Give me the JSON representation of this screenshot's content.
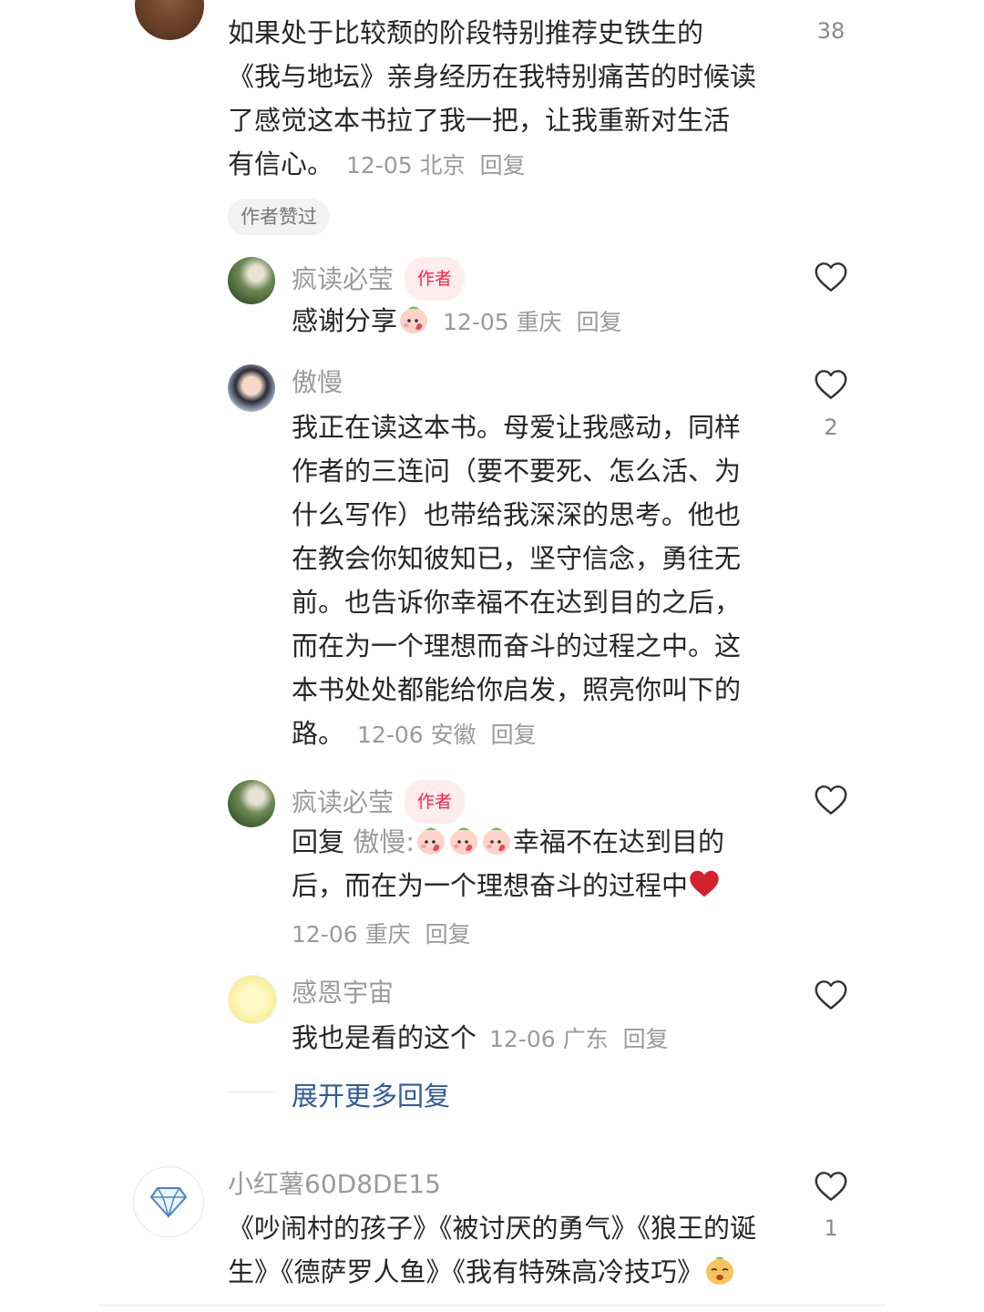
{
  "comments": [
    {
      "text_lines": [
        "如果处于比较颓的阶段特别推荐史铁生的",
        "《我与地坛》亲身经历在我特别痛苦的时候读",
        "了感觉这本书拉了我一把，让我重新对生活",
        "有信心。"
      ],
      "date": "12-05",
      "location": "北京",
      "reply_label": "回复",
      "likes": "38",
      "tag": "作者赞过",
      "replies": [
        {
          "username": "疯读必莹",
          "badge": "作者",
          "text": "感谢分享",
          "date": "12-05",
          "location": "重庆",
          "reply_label": "回复"
        },
        {
          "username": "傲慢",
          "text_lines": [
            "我正在读这本书。母爱让我感动，同样",
            "作者的三连问（要不要死、怎么活、为",
            "什么写作）也带给我深深的思考。他也",
            "在教会你知彼知已，坚守信念，勇往无",
            "前。也告诉你幸福不在达到目的之后，",
            "而在为一个理想而奋斗的过程之中。这",
            "本书处处都能给你启发，照亮你叫下的",
            "路。"
          ],
          "date": "12-06",
          "location": "安徽",
          "reply_label": "回复",
          "likes": "2"
        },
        {
          "username": "疯读必莹",
          "badge": "作者",
          "reply_prefix": "回复",
          "reply_to": "傲慢:",
          "text_line1": "幸福不在达到目的",
          "text_line2": "后，而在为一个理想奋斗的过程中",
          "date": "12-06",
          "location": "重庆",
          "reply_label": "回复"
        },
        {
          "username": "感恩宇宙",
          "text": "我也是看的这个",
          "date": "12-06",
          "location": "广东",
          "reply_label": "回复"
        }
      ],
      "expand_label": "展开更多回复"
    },
    {
      "username": "小红薯60D8DE15",
      "text_lines": [
        "《吵闹村的孩子》《被讨厌的勇气》《狼王的诞",
        "生》《德萨罗人鱼》《我有特殊高冷技巧》"
      ],
      "likes": "1"
    }
  ],
  "icons": {
    "heart": "heart-outline-icon",
    "diamond": "diamond-icon"
  },
  "colors": {
    "author_badge": "#ff2442",
    "link_blue": "#2d5b9c",
    "meta_gray": "#9a9a9a"
  }
}
